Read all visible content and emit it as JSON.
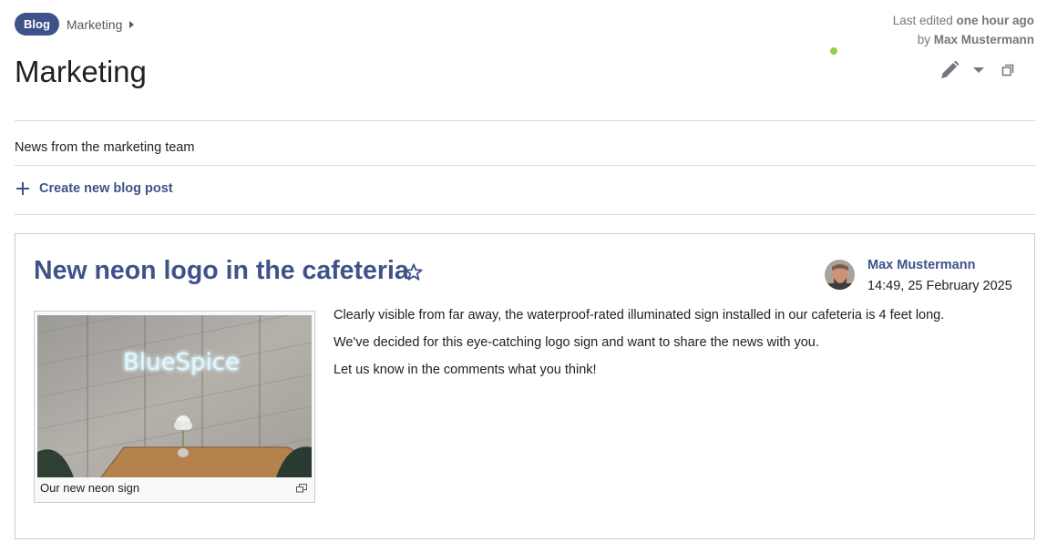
{
  "breadcrumb": {
    "badge": "Blog",
    "current": "Marketing"
  },
  "last_edited": {
    "prefix": "Last edited ",
    "when": "one hour ago",
    "by_prefix": "by ",
    "author": "Max Mustermann"
  },
  "page": {
    "title": "Marketing",
    "description": "News from the marketing team"
  },
  "actions": {
    "edit_icon": "pencil-icon",
    "menu_icon": "chevron-down-icon",
    "expand_icon": "expand-icon"
  },
  "create_link": {
    "icon": "plus-icon",
    "label": "Create new blog post"
  },
  "post": {
    "title": "New neon logo in the cafeteria",
    "star_icon": "star-outline-icon",
    "author": {
      "name": "Max Mustermann",
      "date": "14:49, 25 February 2025",
      "presence": "online"
    },
    "image": {
      "sign_text": "BlueSpice",
      "caption": "Our new neon sign"
    },
    "paragraphs": [
      "Clearly visible from far away, the waterproof-rated illuminated sign installed in our cafeteria is 4 feet long.",
      "We've decided for this eye-catching logo sign and want to share the news with you.",
      "Let us know in the comments what you think!"
    ]
  },
  "colors": {
    "accent": "#3e5389",
    "text": "#202122",
    "muted": "#72777d",
    "rule": "#d8d8d8",
    "presence": "#8fd34a"
  }
}
